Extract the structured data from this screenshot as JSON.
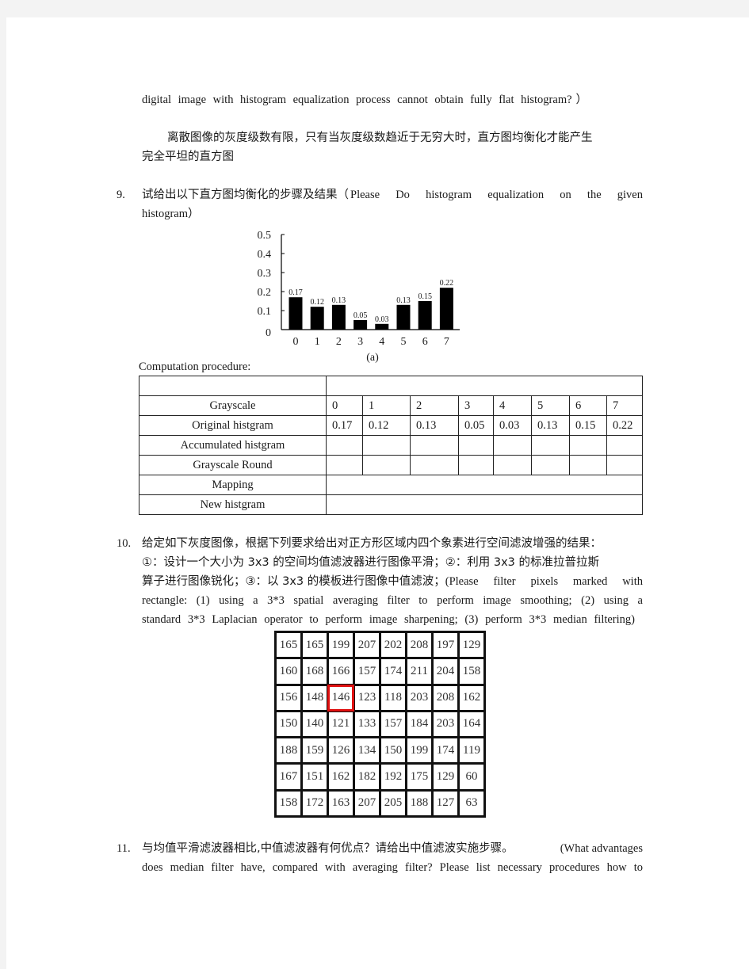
{
  "intro": {
    "line_en": "digital image with histogram equalization process cannot obtain fully flat histogram?）",
    "answer_line1": "离散图像的灰度级数有限，只有当灰度级数趋近于无穷大时，直方图均衡化才能产生",
    "answer_line2": "完全平坦的直方图"
  },
  "q9": {
    "number": "9.",
    "line1_cn": "试给出以下直方图均衡化的步骤及结果（",
    "line1_en": "Please Do histogram equalization on the given",
    "line2": "histogram）",
    "chart_caption": "(a)",
    "procedure_label": "Computation procedure:",
    "table": {
      "header_row": [
        "",
        ""
      ],
      "rows": [
        {
          "label": "Grayscale",
          "values": [
            "0",
            "1",
            "2",
            "3",
            "4",
            "5",
            "6",
            "7"
          ]
        },
        {
          "label": "Original histgram",
          "values": [
            "0.17",
            "0.12",
            "0.13",
            "0.05",
            "0.03",
            "0.13",
            "0.15",
            "0.22"
          ]
        },
        {
          "label": "Accumulated histgram",
          "values": [
            "",
            "",
            "",
            "",
            "",
            "",
            "",
            ""
          ]
        },
        {
          "label": "Grayscale Round",
          "values": [
            "",
            "",
            "",
            "",
            "",
            "",
            "",
            ""
          ]
        },
        {
          "label": "Mapping",
          "merged": ""
        },
        {
          "label": "New histgram",
          "merged": ""
        }
      ]
    }
  },
  "chart_data": {
    "type": "bar",
    "title": "",
    "caption": "(a)",
    "xlabel": "",
    "ylabel": "",
    "categories": [
      "0",
      "1",
      "2",
      "3",
      "4",
      "5",
      "6",
      "7"
    ],
    "values": [
      0.17,
      0.12,
      0.13,
      0.05,
      0.03,
      0.13,
      0.15,
      0.22
    ],
    "data_labels": [
      "0.17",
      "0.12",
      "0.13",
      "0.05",
      "0.03",
      "0.13",
      "0.15",
      "0.22"
    ],
    "yticks": [
      "0",
      "0.1",
      "0.2",
      "0.3",
      "0.4",
      "0.5"
    ],
    "ylim": [
      0,
      0.5
    ],
    "grid": false,
    "legend": "none",
    "bar_color": "#000000"
  },
  "q10": {
    "number": "10.",
    "line1": "给定如下灰度图像，根据下列要求给出对正方形区域内四个象素进行空间滤波增强的结果：",
    "line2": "①：设计一个大小为 3x3 的空间均值滤波器进行图像平滑；②：利用 3x3 的标准拉普拉斯",
    "line3_cn": "算子进行图像锐化；③：以 3x3 的模板进行图像中值滤波；",
    "line3_en": "(Please filter pixels marked with",
    "line4": "rectangle: (1) using a 3*3 spatial averaging filter to perform image smoothing; (2) using a",
    "line5": "standard 3*3 Laplacian operator to perform image sharpening; (3) perform 3*3 median filtering)",
    "marked_cell": {
      "row": 2,
      "col": 2
    },
    "marker_color": "#e01010",
    "image": [
      [
        165,
        165,
        199,
        207,
        202,
        208,
        197,
        129
      ],
      [
        160,
        168,
        166,
        157,
        174,
        211,
        204,
        158
      ],
      [
        156,
        148,
        146,
        123,
        118,
        203,
        208,
        162
      ],
      [
        150,
        140,
        121,
        133,
        157,
        184,
        203,
        164
      ],
      [
        188,
        159,
        126,
        134,
        150,
        199,
        174,
        119
      ],
      [
        167,
        151,
        162,
        182,
        192,
        175,
        129,
        60
      ],
      [
        158,
        172,
        163,
        207,
        205,
        188,
        127,
        63
      ]
    ]
  },
  "q11": {
    "number": "11.",
    "line1_cn": "与均值平滑滤波器相比,中值滤波器有何优点？请给出中值滤波实施步骤。",
    "line1_en": "(What advantages",
    "line2": "does median filter have, compared with averaging filter? Please list necessary procedures how to"
  }
}
